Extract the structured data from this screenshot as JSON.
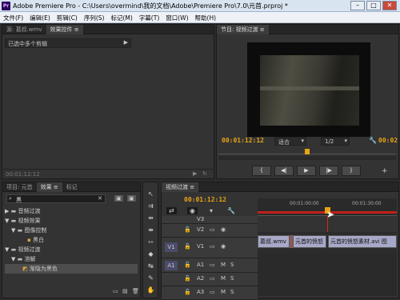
{
  "window": {
    "title": "Adobe Premiere Pro - C:\\Users\\overmind\\我的文档\\Adobe\\Premiere Pro\\7.0\\元首.prproj *",
    "app_icon": "Pr",
    "min": "–",
    "max": "□",
    "close": "✕"
  },
  "menu": [
    "文件(F)",
    "编辑(E)",
    "剪辑(C)",
    "序列(S)",
    "标记(M)",
    "字幕(T)",
    "窗口(W)",
    "帮助(H)"
  ],
  "source_panel": {
    "tabs": [
      "源: 葛叔.wmv",
      "效果控件 ≡"
    ],
    "selected_label": "已选中多个剪辑",
    "timecode": "00:01:12:12"
  },
  "program_panel": {
    "tab": "节目: 视频过渡 ≡",
    "timecode_left": "00:01:12:12",
    "fit": "适合",
    "ratio": "1/2",
    "timecode_right": "00:02"
  },
  "effects_panel": {
    "tabs": [
      "项目: 元首",
      "效果 ≡",
      "标记"
    ],
    "search_value": "黑",
    "tree": [
      {
        "label": "音频过渡",
        "level": 0,
        "expanded": false
      },
      {
        "label": "视频效果",
        "level": 0,
        "expanded": true
      },
      {
        "label": "图像控制",
        "level": 1,
        "expanded": true
      },
      {
        "label": "黑白",
        "level": 2,
        "item": true
      },
      {
        "label": "视频过渡",
        "level": 0,
        "expanded": true
      },
      {
        "label": "溶解",
        "level": 1,
        "expanded": true
      },
      {
        "label": "渐隐为黑色",
        "level": 2,
        "item": true,
        "selected": true
      }
    ]
  },
  "timeline": {
    "tab": "视频过渡 ≡",
    "timecode": "00:01:12:12",
    "ruler": [
      "00:01:00:00",
      "00:01:30:00"
    ],
    "tracks": [
      {
        "name": "V3",
        "src": ""
      },
      {
        "name": "V2",
        "src": ""
      },
      {
        "name": "V1",
        "src": "V1"
      },
      {
        "name": "A1",
        "src": "A1"
      },
      {
        "name": "A2",
        "src": ""
      },
      {
        "name": "A3",
        "src": ""
      }
    ],
    "clips": [
      {
        "label": "葛叔.wmv"
      },
      {
        "label": "元首的愤怒"
      },
      {
        "label": "元首的愤怒素材.avi 图"
      }
    ],
    "mute": "M",
    "solo": "S"
  },
  "colors": {
    "accent": "#e8a317",
    "playhead": "#e0251b",
    "clip": "#a8a8c8"
  }
}
